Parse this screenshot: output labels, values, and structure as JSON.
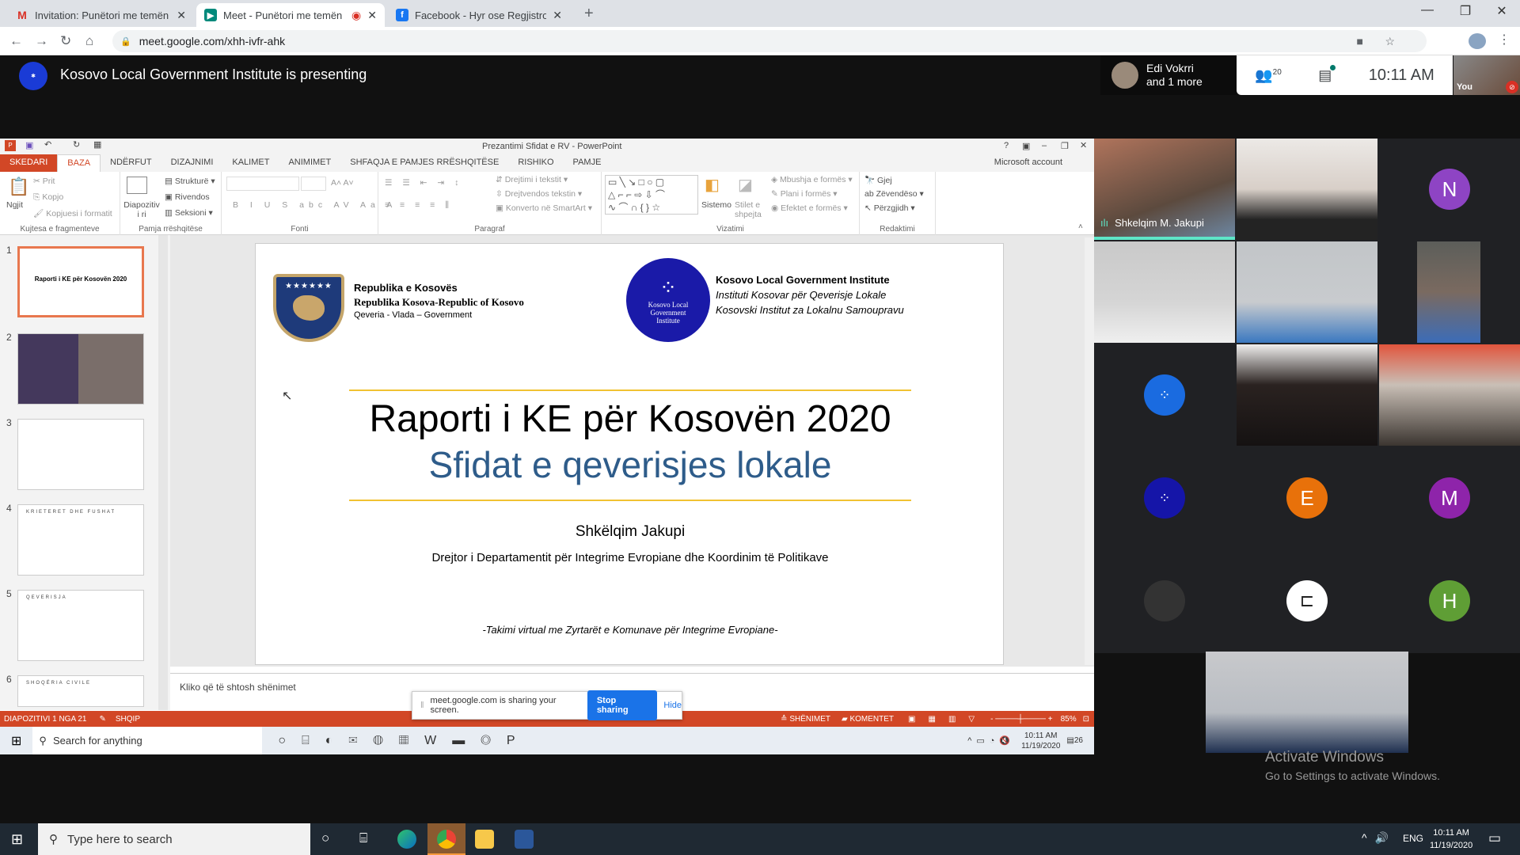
{
  "browser": {
    "tabs": [
      {
        "label": "Invitation: Punëtori me temën 'Q",
        "icon": "gmail-icon",
        "active": false
      },
      {
        "label": "Meet - Punëtori me temën 'C",
        "icon": "meet-icon",
        "active": true,
        "recording": true
      },
      {
        "label": "Facebook - Hyr ose Regjistrohu",
        "icon": "facebook-icon",
        "active": false
      }
    ],
    "url": "meet.google.com/xhh-ivfr-ahk"
  },
  "meet": {
    "presenting_title": "Kosovo Local Government Institute is presenting",
    "pinned_name": "Edi Vokrri",
    "pinned_more": "and 1 more",
    "participants_count": "20",
    "time": "10:11 AM",
    "self_label": "You",
    "active_speaker": "Shkelqim M. Jakupi",
    "avatars": [
      {
        "letter": "N",
        "color": "#8e44c4"
      },
      {
        "letter": "E",
        "color": "#e8710a"
      },
      {
        "letter": "M",
        "color": "#8e24aa"
      },
      {
        "letter": "H",
        "color": "#5f9e35"
      }
    ],
    "activate_title": "Activate Windows",
    "activate_sub": "Go to Settings to activate Windows."
  },
  "ppt": {
    "title": "Prezantimi Sfidat e RV - PowerPoint",
    "account": "Microsoft account",
    "tabs": [
      "SKEDARI",
      "BAZA",
      "NDËRFUT",
      "DIZAJNIMI",
      "KALIMET",
      "ANIMIMET",
      "SHFAQJA E PAMJES RRËSHQITËSE",
      "RISHIKO",
      "PAMJE"
    ],
    "ribbon": {
      "clipboard": {
        "paste": "Ngjit",
        "cut": "Prit",
        "copy": "Kopjo",
        "format": "Kopjuesi i formatit",
        "label": "Kujtesa e fragmenteve"
      },
      "slides": {
        "new": "Diapozitiv i ri",
        "layout": "Strukturë",
        "reset": "Rivendos",
        "section": "Seksioni",
        "label": "Pamja rrëshqitëse"
      },
      "font": {
        "label": "Fonti"
      },
      "paragraph": {
        "dir": "Drejtimi i tekstit",
        "align": "Drejtvendos tekstin",
        "smartart": "Konverto në SmartArt",
        "label": "Paragraf"
      },
      "drawing": {
        "arrange": "Sistemo",
        "styles": "Stilet e shpejta",
        "fill": "Mbushja e formës",
        "outline": "Plani i formës",
        "effects": "Efektet e formës",
        "label": "Vizatimi"
      },
      "editing": {
        "find": "Gjej",
        "replace": "Zëvendëso",
        "select": "Përzgjidh",
        "label": "Redaktimi"
      }
    },
    "slide": {
      "gov_line1": "Republika e Kosovës",
      "gov_line2": "Republika Kosova-Republic of Kosovo",
      "gov_line3": "Qeveria - Vlada – Government",
      "inst_logo_text": "Kosovo Local Government Institute",
      "inst_line1": "Kosovo Local Government Institute",
      "inst_line2": "Instituti Kosovar për Qeverisje Lokale",
      "inst_line3": "Kosovski Institut za Lokalnu Samoupravu",
      "title": "Raporti i KE për Kosovën 2020",
      "subtitle": "Sfidat e qeverisjes lokale",
      "presenter": "Shkëlqim Jakupi",
      "role": "Drejtor i Departamentit për Integrime Evropiane dhe Koordinim të Politikave",
      "footer": "-Takimi virtual me Zyrtarët e Komunave për Integrime Evropiane-"
    },
    "thumbnails": [
      {
        "num": "1",
        "text": "Raporti i KE për Kosovën 2020"
      },
      {
        "num": "2",
        "text": ""
      },
      {
        "num": "3",
        "text": ""
      },
      {
        "num": "4",
        "text": "KRIETERET DHE FUSHAT"
      },
      {
        "num": "5",
        "text": "QEVERISJA"
      },
      {
        "num": "6",
        "text": "SHOQËRIA CIVILE"
      }
    ],
    "notes_placeholder": "Kliko që të shtosh shënimet",
    "status": {
      "slide": "DIAPOZITIVI 1 NGA 21",
      "lang": "SHQIP",
      "notes": "SHËNIMET",
      "comments": "KOMENTET",
      "zoom": "85%"
    },
    "share": {
      "text": "meet.google.com is sharing your screen.",
      "stop": "Stop sharing",
      "hide": "Hide"
    },
    "inner_taskbar": {
      "search": "Search for anything",
      "time": "10:11 AM",
      "date": "11/19/2020",
      "notif": "26"
    }
  },
  "taskbar": {
    "search": "Type here to search",
    "lang": "ENG",
    "time": "10:11 AM",
    "date": "11/19/2020"
  }
}
